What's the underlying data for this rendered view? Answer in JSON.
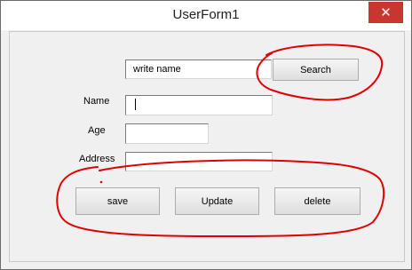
{
  "window": {
    "title": "UserForm1",
    "close_label": "✕"
  },
  "form": {
    "search_input_value": "write name",
    "search_button_label": "Search",
    "name_label": "Name",
    "name_value": "",
    "age_label": "Age",
    "age_value": "",
    "address_label": "Address",
    "address_value": ""
  },
  "actions": {
    "save_label": "save",
    "update_label": "Update",
    "delete_label": "delete"
  },
  "annotation": {
    "color": "#e00000"
  }
}
